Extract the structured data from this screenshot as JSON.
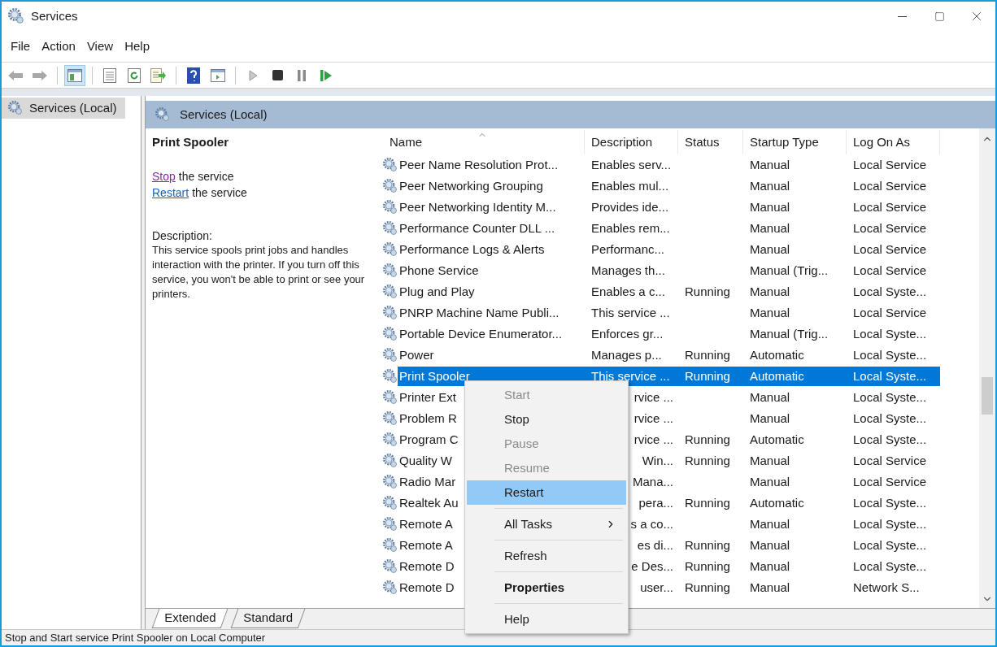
{
  "window": {
    "title": "Services"
  },
  "menu": [
    "File",
    "Action",
    "View",
    "Help"
  ],
  "tree": {
    "items": [
      {
        "label": "Services (Local)",
        "selected": true
      }
    ]
  },
  "panel": {
    "title": "Services (Local)"
  },
  "details": {
    "service_name": "Print Spooler",
    "actions": [
      {
        "link": "Stop",
        "text": "the service",
        "visited": true
      },
      {
        "link": "Restart",
        "text": "the service",
        "visited": false
      }
    ],
    "description_label": "Description:",
    "description": "This service spools print jobs and handles interaction with the printer. If you turn off this service, you won't be able to print or see your printers."
  },
  "table": {
    "columns": [
      "Name",
      "Description",
      "Status",
      "Startup Type",
      "Log On As"
    ],
    "rows": [
      {
        "name": "Peer Name Resolution Prot...",
        "description": "Enables serv...",
        "status": "",
        "startup": "Manual",
        "logon": "Local Service",
        "selected": false
      },
      {
        "name": "Peer Networking Grouping",
        "description": "Enables mul...",
        "status": "",
        "startup": "Manual",
        "logon": "Local Service",
        "selected": false
      },
      {
        "name": "Peer Networking Identity M...",
        "description": "Provides ide...",
        "status": "",
        "startup": "Manual",
        "logon": "Local Service",
        "selected": false
      },
      {
        "name": "Performance Counter DLL ...",
        "description": "Enables rem...",
        "status": "",
        "startup": "Manual",
        "logon": "Local Service",
        "selected": false
      },
      {
        "name": "Performance Logs & Alerts",
        "description": "Performanc...",
        "status": "",
        "startup": "Manual",
        "logon": "Local Service",
        "selected": false
      },
      {
        "name": "Phone Service",
        "description": "Manages th...",
        "status": "",
        "startup": "Manual (Trig...",
        "logon": "Local Service",
        "selected": false
      },
      {
        "name": "Plug and Play",
        "description": "Enables a c...",
        "status": "Running",
        "startup": "Manual",
        "logon": "Local Syste...",
        "selected": false
      },
      {
        "name": "PNRP Machine Name Publi...",
        "description": "This service ...",
        "status": "",
        "startup": "Manual",
        "logon": "Local Service",
        "selected": false
      },
      {
        "name": "Portable Device Enumerator...",
        "description": "Enforces gr...",
        "status": "",
        "startup": "Manual (Trig...",
        "logon": "Local Syste...",
        "selected": false
      },
      {
        "name": "Power",
        "description": "Manages p...",
        "status": "Running",
        "startup": "Automatic",
        "logon": "Local Syste...",
        "selected": false
      },
      {
        "name": "Print Spooler",
        "description": "This service ...",
        "status": "Running",
        "startup": "Automatic",
        "logon": "Local Syste...",
        "selected": true
      },
      {
        "name": "Printer Ext",
        "description": "rvice ...",
        "status": "",
        "startup": "Manual",
        "logon": "Local Syste...",
        "selected": false
      },
      {
        "name": "Problem R",
        "description": "rvice ...",
        "status": "",
        "startup": "Manual",
        "logon": "Local Syste...",
        "selected": false
      },
      {
        "name": "Program C",
        "description": "rvice ...",
        "status": "Running",
        "startup": "Automatic",
        "logon": "Local Syste...",
        "selected": false
      },
      {
        "name": "Quality W",
        "description": "Win...",
        "status": "Running",
        "startup": "Manual",
        "logon": "Local Service",
        "selected": false
      },
      {
        "name": "Radio Mar",
        "description": "Mana...",
        "status": "",
        "startup": "Manual",
        "logon": "Local Service",
        "selected": false
      },
      {
        "name": "Realtek Au",
        "description": "pera...",
        "status": "Running",
        "startup": "Automatic",
        "logon": "Local Syste...",
        "selected": false
      },
      {
        "name": "Remote A",
        "description": "s a co...",
        "status": "",
        "startup": "Manual",
        "logon": "Local Syste...",
        "selected": false
      },
      {
        "name": "Remote A",
        "description": "es di...",
        "status": "Running",
        "startup": "Manual",
        "logon": "Local Syste...",
        "selected": false
      },
      {
        "name": "Remote D",
        "description": "e Des...",
        "status": "Running",
        "startup": "Manual",
        "logon": "Local Syste...",
        "selected": false
      },
      {
        "name": "Remote D",
        "description": "user...",
        "status": "Running",
        "startup": "Manual",
        "logon": "Network S...",
        "selected": false
      }
    ]
  },
  "context_menu": [
    {
      "kind": "item",
      "label": "Start",
      "disabled": true,
      "selected": false,
      "bold": false
    },
    {
      "kind": "item",
      "label": "Stop",
      "disabled": false,
      "selected": false,
      "bold": false
    },
    {
      "kind": "item",
      "label": "Pause",
      "disabled": true,
      "selected": false,
      "bold": false
    },
    {
      "kind": "item",
      "label": "Resume",
      "disabled": true,
      "selected": false,
      "bold": false
    },
    {
      "kind": "item",
      "label": "Restart",
      "disabled": false,
      "selected": true,
      "bold": false
    },
    {
      "kind": "separator"
    },
    {
      "kind": "submenu",
      "label": "All Tasks",
      "disabled": false,
      "selected": false,
      "bold": false
    },
    {
      "kind": "separator"
    },
    {
      "kind": "item",
      "label": "Refresh",
      "disabled": false,
      "selected": false,
      "bold": false
    },
    {
      "kind": "separator"
    },
    {
      "kind": "item",
      "label": "Properties",
      "disabled": false,
      "selected": false,
      "bold": true
    },
    {
      "kind": "separator"
    },
    {
      "kind": "item",
      "label": "Help",
      "disabled": false,
      "selected": false,
      "bold": false
    }
  ],
  "view_tabs": [
    {
      "label": "Extended",
      "selected": true
    },
    {
      "label": "Standard",
      "selected": false
    }
  ],
  "status_bar": "Stop and Start service Print Spooler on Local Computer"
}
